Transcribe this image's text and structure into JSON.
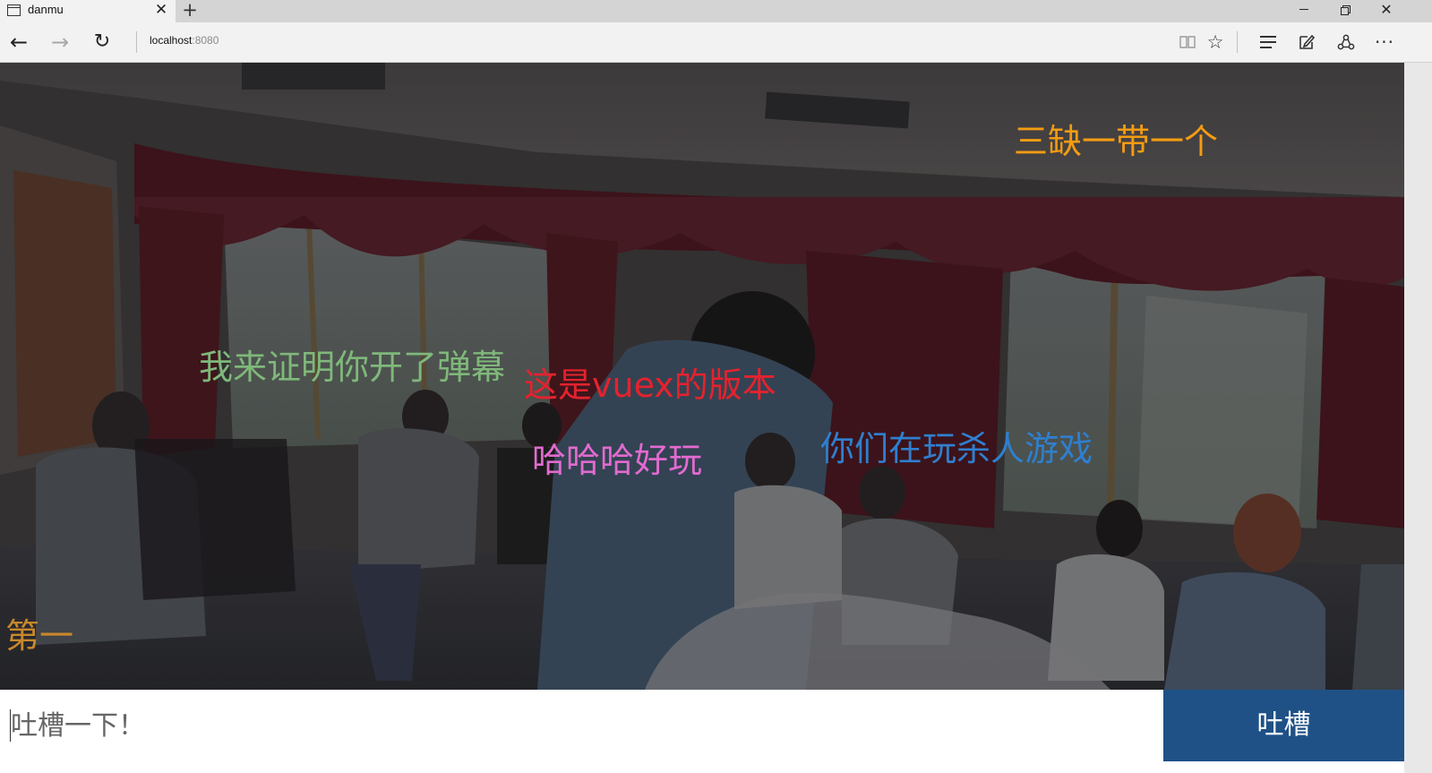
{
  "browser": {
    "tab_title": "danmu",
    "tab_close_glyph": "✕",
    "new_tab_glyph": "+",
    "address_host": "localhost",
    "address_port": ":8080",
    "icons": {
      "tab_page": "page-icon",
      "back": "back-arrow-icon",
      "forward": "forward-arrow-icon",
      "refresh": "refresh-icon",
      "reading_view": "reading-view-icon",
      "favorite": "star-icon",
      "hub": "hub-icon",
      "web_note": "web-note-icon",
      "share": "share-icon",
      "more": "more-icon",
      "minimize": "minimize-icon",
      "maximize": "restore-icon",
      "close": "close-icon"
    },
    "glyphs": {
      "back": "←",
      "forward": "→",
      "refresh": "↻",
      "reading_view": "▯▯",
      "favorite": "☆",
      "web_note": "✎",
      "share": "⟲",
      "more": "···",
      "close": "✕"
    }
  },
  "app": {
    "background_image": "dim classroom photo of people seated on chairs",
    "danmu": [
      {
        "text": "三缺一带一个",
        "color": "#f39c12"
      },
      {
        "text": "我来证明你开了弹幕",
        "color": "#7fb87a"
      },
      {
        "text": "这是vuex的版本",
        "color": "#e5222e"
      },
      {
        "text": "哈哈哈好玩",
        "color": "#e36ad0"
      },
      {
        "text": "你们在玩杀人游戏",
        "color": "#2f7fcf"
      },
      {
        "text": "第一",
        "color": "#c8882c"
      }
    ],
    "input": {
      "placeholder": "吐槽一下！",
      "value": ""
    },
    "send_label": "吐槽",
    "send_color": "#1f5186"
  }
}
